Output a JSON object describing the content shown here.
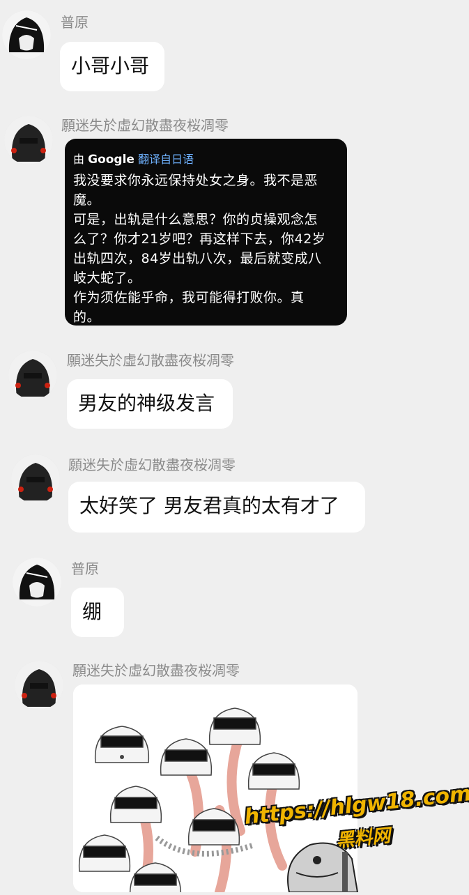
{
  "messages": [
    {
      "sender": "普原",
      "text": "小哥小哥"
    },
    {
      "sender": "願迷失於虛幻散盡夜桜凋零",
      "translation": {
        "by": "由",
        "brand": "Google",
        "label": "翻译自日语",
        "lines": [
          "我没要求你永远保持处女之身。我不是恶",
          "魔。",
          "可是，出轨是什么意思？你的贞操观念怎",
          "么了？你才21岁吧？再这样下去，你42岁",
          "出轨四次，84岁出轨八次，最后就变成八",
          "岐大蛇了。",
          "作为须佐能乎命，我可能得打败你。真",
          "的。"
        ]
      }
    },
    {
      "sender": "願迷失於虛幻散盡夜桜凋零",
      "text": "男友的神级发言"
    },
    {
      "sender": "願迷失於虛幻散盡夜桜凋零",
      "text": "太好笑了 男友君真的太有才了"
    },
    {
      "sender": "普原",
      "text": "绷"
    },
    {
      "sender": "願迷失於虛幻散盡夜桜凋零",
      "image": "multi-headed-girls-drawing"
    }
  ],
  "watermark": {
    "url": "https://hlgw18.com",
    "label": "黑料网"
  },
  "colors": {
    "background": "#efefef",
    "bubble": "#ffffff",
    "translate_bg": "#0a0a0a",
    "translate_lang": "#6fb2ff",
    "watermark": "#f0b400"
  }
}
